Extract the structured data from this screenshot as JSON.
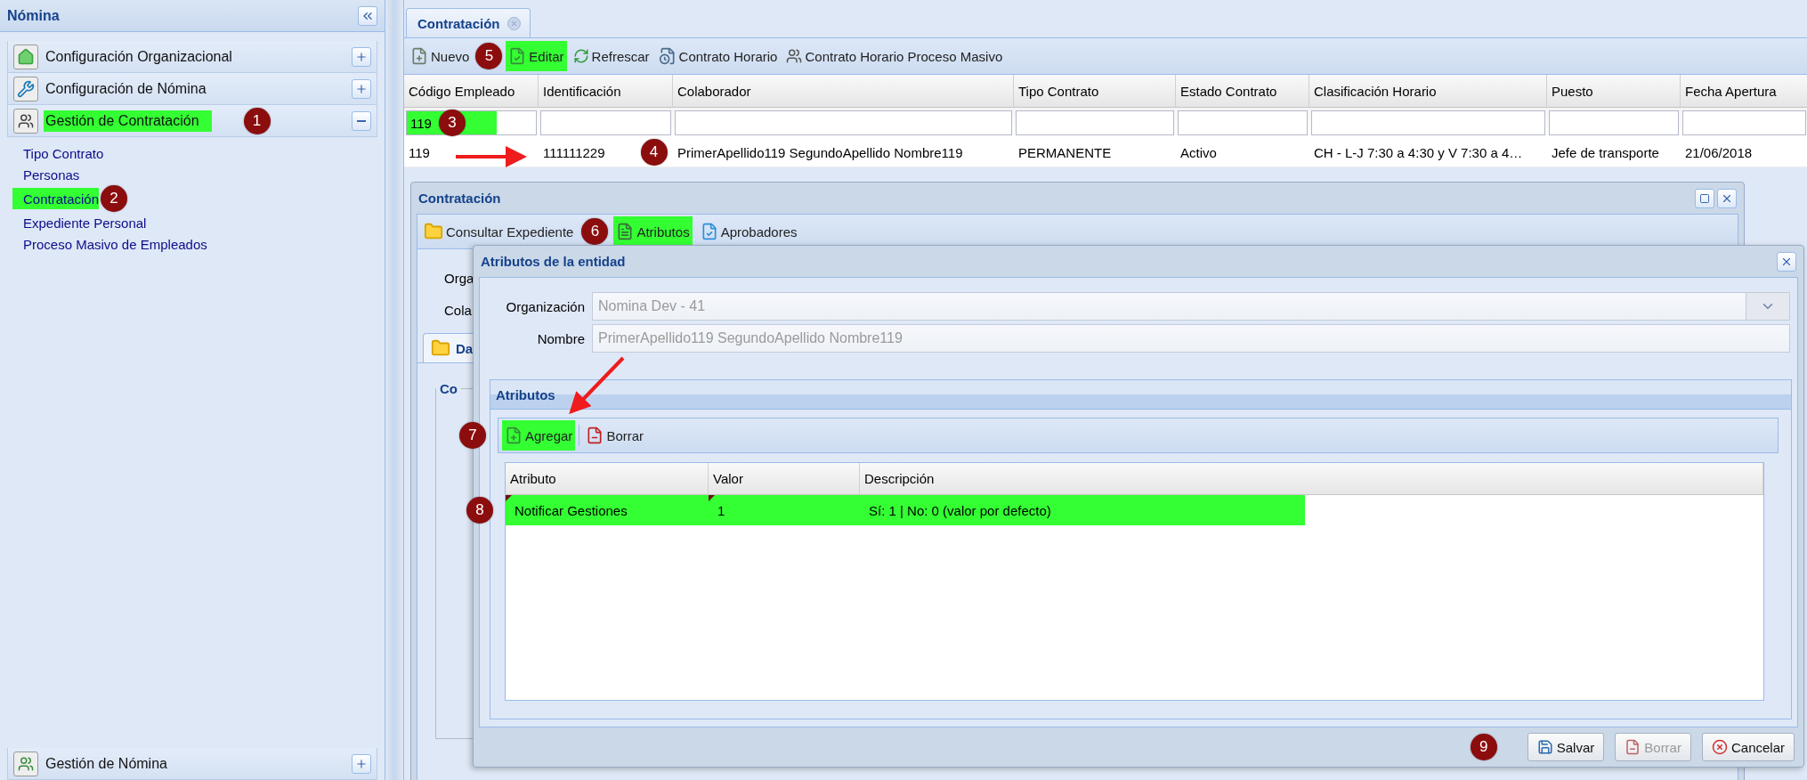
{
  "sidebar": {
    "title": "Nómina",
    "sections": [
      {
        "label": "Configuración Organizacional",
        "expanded": false,
        "highlighted": false
      },
      {
        "label": "Configuración de Nómina",
        "expanded": false,
        "highlighted": false
      },
      {
        "label": "Gestión de Contratación",
        "expanded": true,
        "highlighted": true,
        "badge": "1",
        "children": [
          {
            "label": "Tipo Contrato",
            "highlighted": false
          },
          {
            "label": "Personas",
            "highlighted": false
          },
          {
            "label": "Contratación",
            "highlighted": true,
            "badge": "2"
          },
          {
            "label": "Expediente Personal",
            "highlighted": false
          },
          {
            "label": "Proceso Masivo de Empleados",
            "highlighted": false
          }
        ]
      },
      {
        "label": "Gestión de Nómina",
        "expanded": false,
        "highlighted": false
      }
    ]
  },
  "tabs": [
    {
      "label": "Contratación",
      "selected": true
    }
  ],
  "toolbar": [
    {
      "label": "Nuevo",
      "highlighted": false,
      "badge": "5"
    },
    {
      "label": "Editar",
      "highlighted": true
    },
    {
      "label": "Refrescar",
      "highlighted": false
    },
    {
      "label": "Contrato Horario",
      "highlighted": false
    },
    {
      "label": "Contrato Horario Proceso Masivo",
      "highlighted": false
    }
  ],
  "grid": {
    "columns": [
      "Código Empleado",
      "Identificación",
      "Colaborador",
      "Tipo Contrato",
      "Estado Contrato",
      "Clasificación Horario",
      "Puesto",
      "Fecha Apertura"
    ],
    "filters": [
      {
        "value": "119",
        "highlighted": true,
        "badge": "3"
      },
      {
        "highlighted": false
      },
      {
        "highlighted": false
      },
      {
        "highlighted": false
      },
      {
        "highlighted": false
      },
      {
        "highlighted": false
      },
      {
        "highlighted": false
      },
      {
        "highlighted": false
      }
    ],
    "rows": [
      {
        "cells": [
          "119",
          "111111229",
          "PrimerApellido119 SegundoApellido Nombre119",
          "PERMANENTE",
          "Activo",
          "CH - L-J 7:30 a 4:30 y V 7:30 a 4…",
          "Jefe de transporte",
          "21/06/2018"
        ],
        "badge": "4"
      }
    ]
  },
  "window": {
    "title": "Contratación",
    "toolbar": [
      {
        "label": "Consultar Expediente",
        "highlighted": false,
        "badge": "6"
      },
      {
        "label": "Atributos",
        "highlighted": true
      },
      {
        "label": "Aprobadores",
        "highlighted": false
      }
    ],
    "fields": [
      "Orga",
      "Cola"
    ],
    "tabs": [
      {
        "label": "Da",
        "selected": true
      }
    ],
    "fieldset": "Co"
  },
  "dialog": {
    "title": "Atributos de la entidad",
    "fields": [
      {
        "kind": "combo",
        "label": "Organización",
        "value": "Nomina Dev - 41",
        "disabled": true
      },
      {
        "kind": "text",
        "label": "Nombre",
        "value": "PrimerApellido119 SegundoApellido Nombre119",
        "disabled": true
      }
    ],
    "panel": {
      "title": "Atributos",
      "toolbar": [
        {
          "label": "Agregar",
          "highlighted": true,
          "badge": "7"
        },
        {
          "label": "Borrar",
          "highlighted": false
        }
      ],
      "columns": [
        "Atributo",
        "Valor",
        "Descripción"
      ],
      "rows": [
        {
          "cells": [
            "Notificar Gestiones",
            "1",
            "Sí: 1 | No: 0 (valor por defecto)"
          ],
          "highlighted": true,
          "dirty": true,
          "badge": "8"
        }
      ]
    },
    "footer_badge": "9",
    "buttons": [
      {
        "label": "Salvar",
        "disabled": false
      },
      {
        "label": "Borrar",
        "disabled": true
      },
      {
        "label": "Cancelar",
        "disabled": false
      }
    ]
  }
}
